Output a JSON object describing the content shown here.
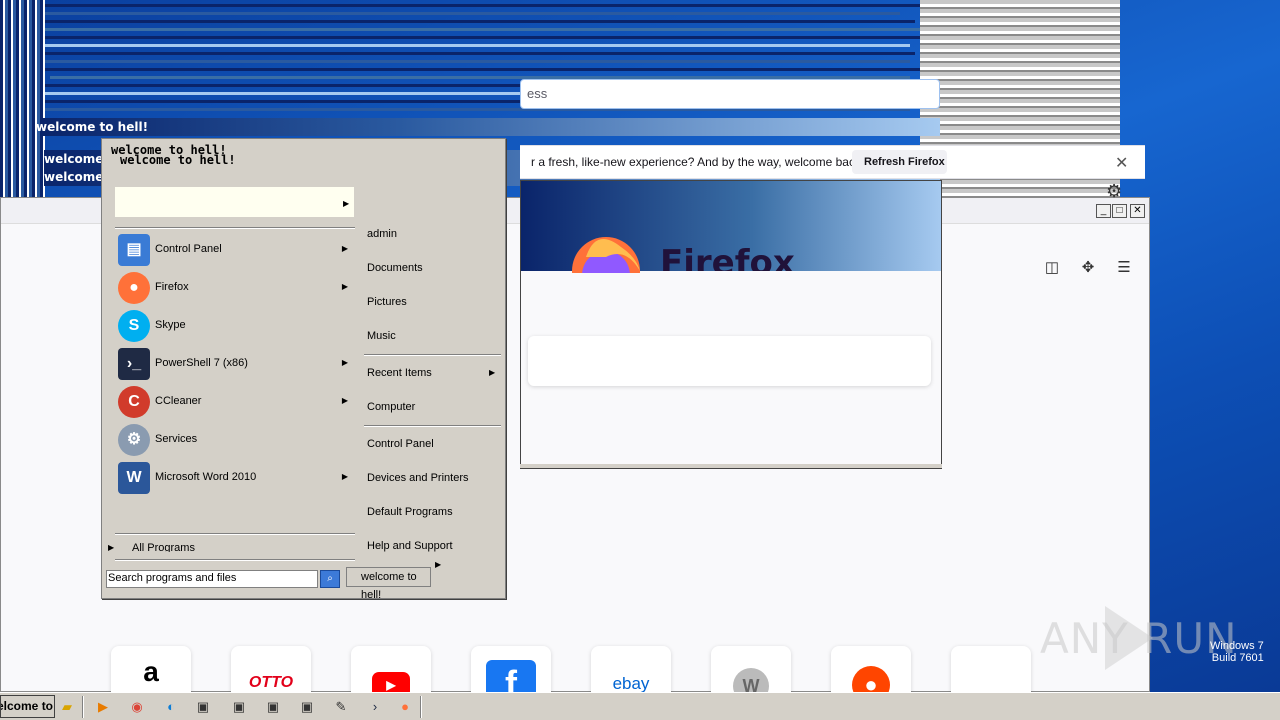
{
  "colors": {
    "desktop": "#1e5cb3",
    "titlebar_dark": "#0a246a",
    "titlebar_light": "#a6caf0",
    "menu_bg": "#d4d0c8",
    "firefox_bg": "#f9f9fb"
  },
  "glitch_windows": {
    "title": "welcome to hell!",
    "title_truncated": "welcome to hell!"
  },
  "firefox": {
    "url_text": "ess",
    "notification_text": "r a fresh, like-new experience? And by the way, welcome back!",
    "refresh_button": "Refresh Firefox",
    "wordmark": "Firefox",
    "toolbar_icons": [
      "pocket-icon",
      "extensions-icon",
      "menu-icon"
    ],
    "top_sites": [
      {
        "name": "amazon",
        "glyph": "a",
        "color": "#000000"
      },
      {
        "name": "otto",
        "glyph": "OTTO",
        "color": "#e2001a"
      },
      {
        "name": "youtube",
        "glyph": "▶",
        "color": "#ff0000"
      },
      {
        "name": "facebook",
        "glyph": "f",
        "color": "#1877f2"
      },
      {
        "name": "ebay",
        "glyph": "ebay",
        "color": "#0064d2"
      },
      {
        "name": "wikipedia",
        "glyph": "W",
        "color": "#888888"
      },
      {
        "name": "reddit",
        "glyph": "●",
        "color": "#ff4500"
      },
      {
        "name": "empty",
        "glyph": "",
        "color": "#ffffff"
      }
    ]
  },
  "start_menu": {
    "header_line1": "welcome to hell!",
    "header_line2": "welcome to hell!",
    "left_items": [
      {
        "label": "Control Panel",
        "icon": "control-panel-icon",
        "arrow": true,
        "color": "#3a7bd5"
      },
      {
        "label": "Firefox",
        "icon": "firefox-icon",
        "arrow": true,
        "color": "#ff7139"
      },
      {
        "label": "Skype",
        "icon": "skype-icon",
        "arrow": false,
        "color": "#00aff0"
      },
      {
        "label": "PowerShell 7 (x86)",
        "icon": "powershell-icon",
        "arrow": true,
        "color": "#1f2a44"
      },
      {
        "label": "CCleaner",
        "icon": "ccleaner-icon",
        "arrow": true,
        "color": "#d13b2b"
      },
      {
        "label": "Services",
        "icon": "services-icon",
        "arrow": false,
        "color": "#8a9bb0"
      },
      {
        "label": "Microsoft Word 2010",
        "icon": "word-icon",
        "arrow": true,
        "color": "#2b579a"
      }
    ],
    "all_programs": "All Programs",
    "right_items": [
      {
        "label": "admin",
        "arrow": false
      },
      {
        "label": "Documents",
        "arrow": false
      },
      {
        "label": "Pictures",
        "arrow": false
      },
      {
        "label": "Music",
        "arrow": false
      },
      {
        "label": "Recent Items",
        "arrow": true
      },
      {
        "label": "Computer",
        "arrow": false
      },
      {
        "label": "Control Panel",
        "arrow": false
      },
      {
        "label": "Devices and Printers",
        "arrow": false
      },
      {
        "label": "Default Programs",
        "arrow": false
      },
      {
        "label": "Help and Support",
        "arrow": false
      }
    ],
    "search_placeholder": "Search programs and files",
    "shutdown_label": "welcome to hell!"
  },
  "taskbar": {
    "start_label": "elcome to",
    "icons": [
      "explorer-icon",
      "media-player-icon",
      "chrome-icon",
      "edge-icon",
      "window-icon",
      "window-icon",
      "window-icon",
      "window-icon",
      "notepad-icon",
      "powershell-icon",
      "firefox-icon"
    ]
  },
  "watermark": "ANY RUN",
  "windows_version": "Windows 7\nBuild 7601"
}
